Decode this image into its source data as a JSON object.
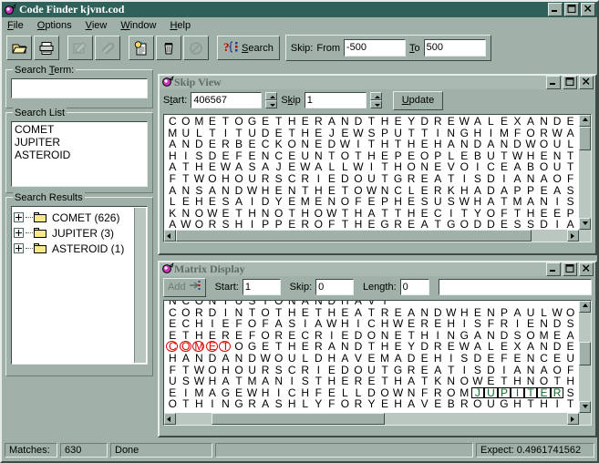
{
  "window": {
    "title": "Code Finder kjvnt.cod",
    "icon": "app-icon",
    "minimize": "_",
    "maximize": "□",
    "close": "×"
  },
  "menubar": [
    {
      "label": "File",
      "accel": "F"
    },
    {
      "label": "Options",
      "accel": "O"
    },
    {
      "label": "View",
      "accel": "V"
    },
    {
      "label": "Window",
      "accel": "W"
    },
    {
      "label": "Help",
      "accel": "H"
    }
  ],
  "toolbar": {
    "buttons": [
      {
        "name": "open-file-button",
        "icon": "folder-open-icon",
        "enabled": true
      },
      {
        "name": "print-button",
        "icon": "printer-icon",
        "enabled": true
      },
      {
        "name": "edit-button",
        "icon": "pencil-note-icon",
        "enabled": false
      },
      {
        "name": "attach-button",
        "icon": "paperclip-icon",
        "enabled": false
      },
      {
        "name": "new-report-button",
        "icon": "document-star-icon",
        "enabled": true
      },
      {
        "name": "delete-button",
        "icon": "trash-icon",
        "enabled": true
      },
      {
        "name": "cancel-button",
        "icon": "no-entry-icon",
        "enabled": false
      }
    ],
    "search_label": "Search",
    "search_accel": "S",
    "search_icon": "question-braces-icon",
    "skip_label": "Skip:",
    "from_label": "From",
    "from_value": "-500",
    "to_label": "To",
    "to_accel": "T",
    "to_value": "500"
  },
  "left_panel": {
    "search_term": {
      "legend": "Search Term:",
      "legend_accel": "T",
      "value": "",
      "placeholder": ""
    },
    "search_list": {
      "legend": "Search List",
      "items": [
        "COMET",
        "JUPITER",
        "ASTEROID"
      ]
    },
    "search_results": {
      "legend": "Search Results",
      "items": [
        {
          "label": "COMET (626)",
          "expander": "+",
          "icon": "folder-icon"
        },
        {
          "label": "JUPITER (3)",
          "expander": "+",
          "icon": "folder-icon"
        },
        {
          "label": "ASTEROID (1)",
          "expander": "+",
          "icon": "folder-icon"
        }
      ]
    }
  },
  "skip_view": {
    "title": "Skip View",
    "icon": "app-icon",
    "minimize": "_",
    "maximize": "□",
    "close": "×",
    "start_label": "Start:",
    "start_accel": "t",
    "start_value": "406567",
    "skip_label": "Skip",
    "skip_accel": "k",
    "skip_value": "1",
    "update_label": "Update",
    "update_accel": "U",
    "rows": [
      "COMETOGETHERANDTHEYDREWALEXANDE",
      "MULTITUDETHEJEWSPUTTINGHIMFORWA",
      "ANDERBECKONEDWITHTHEHANDANDWOUL",
      "HISDEFENCEUNTOTHEPEOPLEBUTWHENT",
      "ATHEWASAJEWALLWITHONEVOICEABOUT",
      "FTWOHOURSCRIEDOUTGREATISDIANAOF",
      "ANSANDWHENTHETOWNCLERKHADAPPEAS",
      "LEHESAIDYEMENOFEPHESUSWHATMANIS",
      "KNOWETHNOTHOWTHATTHECITYOFTHEEP",
      "AWORSHIPPEROFTHEGREATGODDESSDIA"
    ]
  },
  "matrix_display": {
    "title": "Matrix Display",
    "icon": "app-icon",
    "minimize": "_",
    "maximize": "□",
    "close": "×",
    "add_label": "Add",
    "add_icon": "add-row-icon",
    "add_enabled": false,
    "start_label": "Start:",
    "start_value": "1",
    "skip_label": "Skip:",
    "skip_value": "0",
    "length_label": "Length:",
    "length_value": "0",
    "note_value": "",
    "highlight_colors": {
      "circled": "#e00000",
      "boxed": "#0a6b27"
    },
    "rows": [
      {
        "text": "NCONTUSTONANDHAVI",
        "clipped": true,
        "marks": []
      },
      {
        "text": "CORDINTOTHETHEATREANDWHENPAULWO",
        "marks": []
      },
      {
        "text": "ECHIEFOFASIAWHICHWEREHISFRIENDS",
        "marks": []
      },
      {
        "text": "ETHEREFORECRIEDONETHINGANDSOMEA",
        "marks": []
      },
      {
        "text": "COMETOGETHERANDTHEYDREWALEXANDE",
        "marks": [
          {
            "type": "circle",
            "start": 0,
            "len": 5
          }
        ]
      },
      {
        "text": "HANDANDWOULDHAVEMADEHISDEFENCEU",
        "marks": []
      },
      {
        "text": "FTWOHOURSCRIEDOUTGREATISDIANAOF",
        "marks": []
      },
      {
        "text": "USWHATMANISTHERETHATKNOWETHNOTH",
        "marks": []
      },
      {
        "text": "EIMAGEWHICHFELLDOWNFROMJUPITERS",
        "marks": [
          {
            "type": "box",
            "start": 23,
            "len": 7
          }
        ]
      },
      {
        "text": "OTHINGRASHLYFORYEHAVEBROUGHTHIT",
        "marks": []
      }
    ]
  },
  "status_bar": {
    "matches_label": "Matches:",
    "matches_value": "630",
    "state": "Done",
    "message": "",
    "expect": "Expect: 0.4961741562"
  }
}
